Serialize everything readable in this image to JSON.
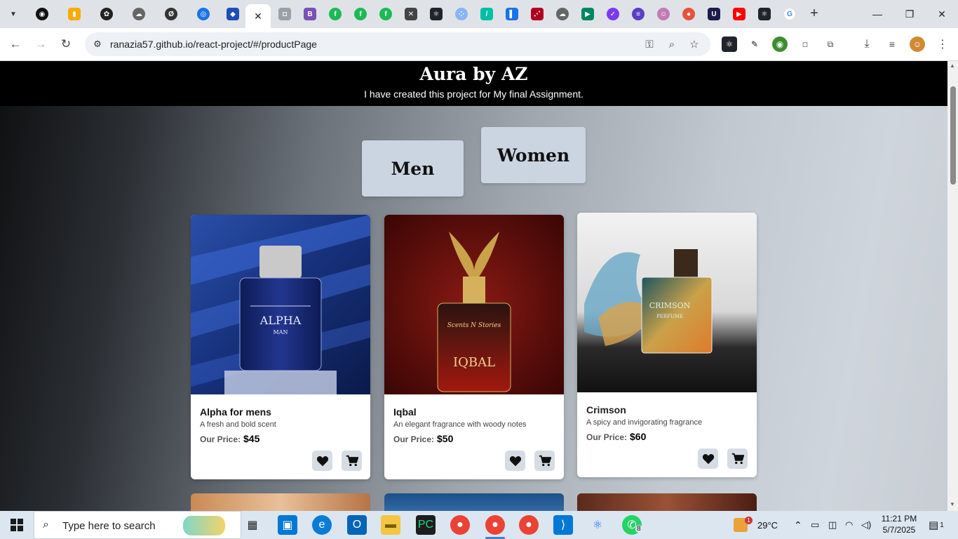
{
  "browser": {
    "url": "ranazia57.github.io/react-project/#/productPage",
    "active_tab_close": "✕"
  },
  "site": {
    "title": "Aura by AZ",
    "subtitle": "I have created this project for My final Assignment."
  },
  "categories": {
    "men": "Men",
    "women": "Women"
  },
  "products": [
    {
      "name": "Alpha for mens",
      "description": "A fresh and bold scent",
      "price_label": "Our Price:",
      "price": "$45",
      "bottle_text": "ALPHA",
      "bottle_sub": "MAN"
    },
    {
      "name": "Iqbal",
      "description": "An elegant fragrance with woody notes",
      "price_label": "Our Price:",
      "price": "$50",
      "bottle_text": "IQBAL",
      "bottle_sub": "Scents N Stories"
    },
    {
      "name": "Crimson",
      "description": "A spicy and invigorating fragrance",
      "price_label": "Our Price:",
      "price": "$60",
      "bottle_text": "CRIMSON",
      "bottle_sub": "PERFUME"
    }
  ],
  "taskbar": {
    "search_placeholder": "Type here to search",
    "temperature": "29°C",
    "time": "11:21 PM",
    "date": "5/7/2025",
    "notifications": "1",
    "whatsapp_badge": "8",
    "weather_badge": "1"
  },
  "colors": {
    "header_bg": "#000000",
    "category_button_bg": "#cbd5e1",
    "card_bg": "#ffffff"
  }
}
